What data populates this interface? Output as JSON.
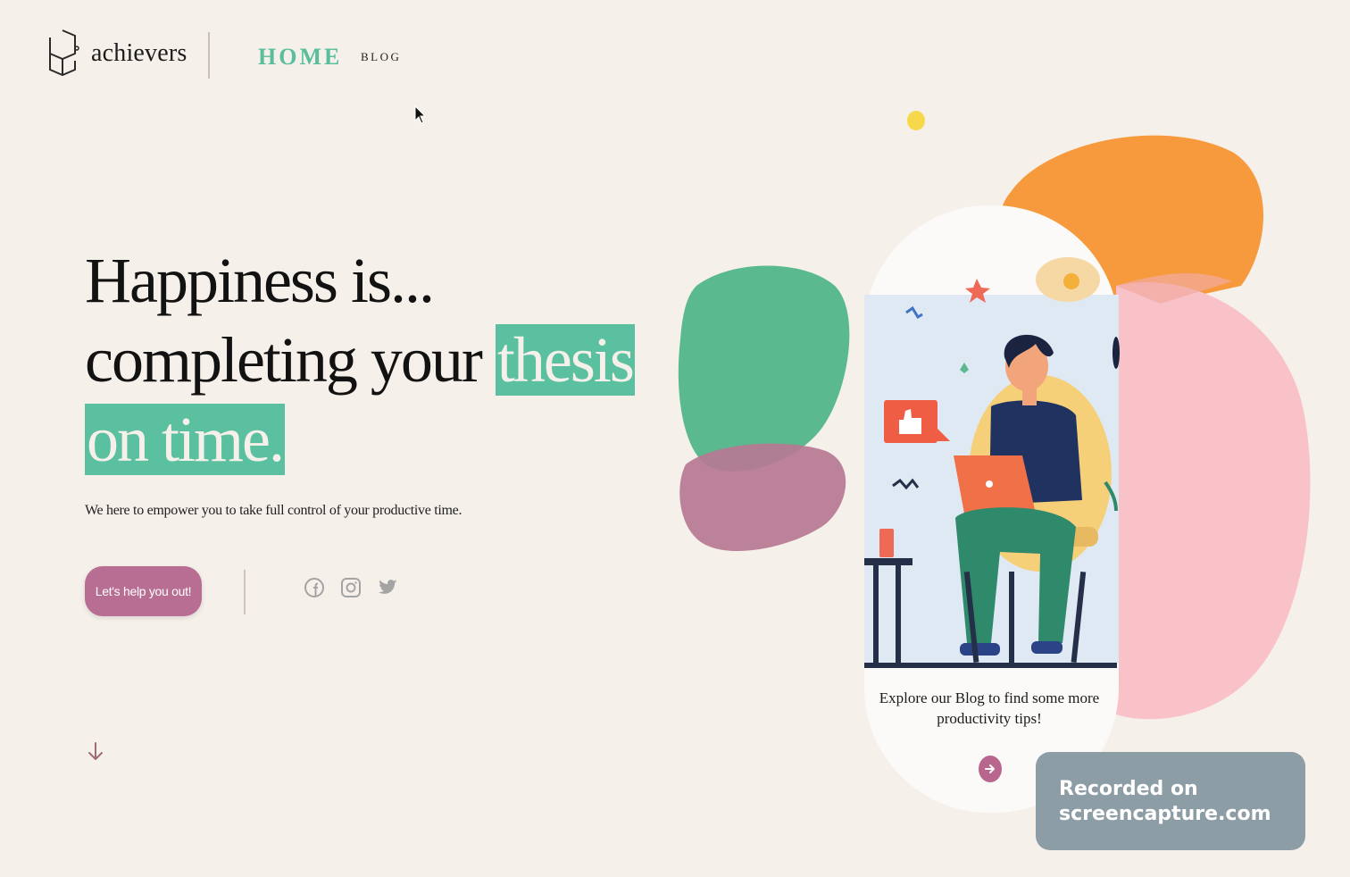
{
  "header": {
    "brand": "achievers",
    "nav": [
      {
        "label": "HOME",
        "active": true
      },
      {
        "label": "BLOG",
        "active": false
      }
    ]
  },
  "hero": {
    "title_line1": "Happiness is...",
    "title_line2_plain": "completing your",
    "title_line2_highlight": "thesis",
    "title_line3_highlight": "on time.",
    "tagline": "We here to empower you to take full control of your productive time.",
    "cta_label": "Let's help you out!",
    "social_icons": [
      "facebook-icon",
      "instagram-icon",
      "twitter-icon"
    ]
  },
  "phone_card": {
    "text": "Explore our Blog to find some more productivity tips!",
    "button_icon": "arrow-right-icon"
  },
  "recording_badge": {
    "line1": "Recorded on",
    "line2": "screencapture.com"
  },
  "colors": {
    "background": "#f6f0ea",
    "accent_green": "#5bc0a0",
    "accent_pink": "#b86d93",
    "blob_orange": "#f79a3e",
    "blob_pink": "#f8c2c8"
  }
}
